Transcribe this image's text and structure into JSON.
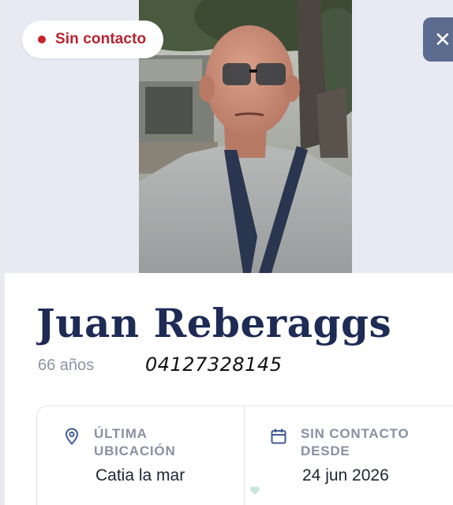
{
  "status": {
    "label": "Sin contacto",
    "color": "#c8232c"
  },
  "close_icon": "close-icon",
  "person": {
    "name": "Juan Reberaggs",
    "age": "66 años",
    "phone": "04127328145"
  },
  "last_location": {
    "label_line1": "ÚLTIMA",
    "label_line2": "UBICACIÓN",
    "value": "Catia la mar",
    "icon": "location-pin-icon"
  },
  "no_contact_since": {
    "label_line1": "SIN CONTACTO",
    "label_line2": "DESDE",
    "value": "24 jun 2026",
    "icon": "calendar-icon"
  },
  "colors": {
    "accent": "#5c6c8e",
    "name": "#1d2b55",
    "status": "#b82230"
  }
}
